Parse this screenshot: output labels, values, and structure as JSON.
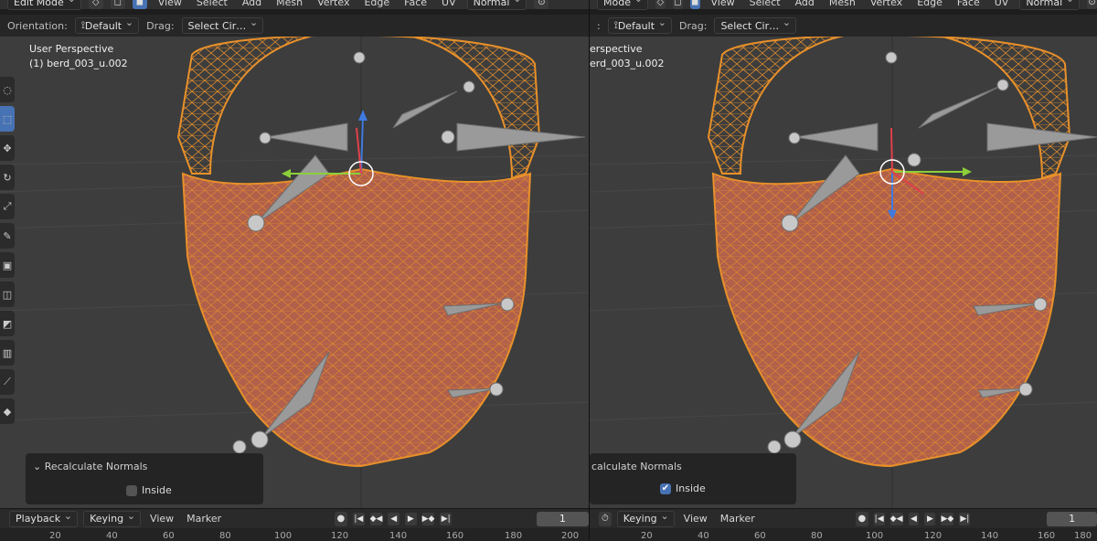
{
  "left": {
    "mode": "Edit Mode",
    "menus": [
      "View",
      "Select",
      "Add",
      "Mesh",
      "Vertex",
      "Edge",
      "Face",
      "UV"
    ],
    "transform_orientation": "Normal",
    "orientation_label": "Orientation:",
    "orientation_value": "Default",
    "drag_label": "Drag:",
    "drag_value": "Select Cir…",
    "perspective": "User Perspective",
    "object_name": "(1) berd_003_u.002",
    "redo_title": "Recalculate Normals",
    "inside_label": "Inside",
    "inside_checked": false
  },
  "right": {
    "mode": "Mode",
    "menus": [
      "View",
      "Select",
      "Add",
      "Mesh",
      "Vertex",
      "Edge",
      "Face",
      "UV"
    ],
    "transform_orientation": "Normal",
    "orientation_label": ":",
    "orientation_value": "Default",
    "drag_label": "Drag:",
    "drag_value": "Select Cir…",
    "perspective": "erspective",
    "object_name": "erd_003_u.002",
    "redo_title": "calculate Normals",
    "inside_label": "Inside",
    "inside_checked": true
  },
  "timeline_left": {
    "playback": "Playback",
    "keying": "Keying",
    "view": "View",
    "marker": "Marker",
    "frame": "1",
    "ticks": [
      "20",
      "40",
      "60",
      "80",
      "100",
      "120",
      "140",
      "160",
      "180",
      "200"
    ]
  },
  "timeline_right": {
    "keying": "Keying",
    "view": "View",
    "marker": "Marker",
    "frame": "1",
    "ticks": [
      "20",
      "40",
      "60",
      "80",
      "100",
      "120",
      "140",
      "160",
      "180"
    ]
  },
  "colors": {
    "mesh_wire": "#e8902a",
    "mesh_fill": "#b0604b",
    "viewport_bg": "#3d3d3d",
    "accent": "#4772b3"
  },
  "icons": [
    "cursor-icon",
    "move-icon",
    "rotate-icon",
    "scale-icon",
    "transform-icon",
    "annotate-icon",
    "measure-icon",
    "extrude-icon",
    "inset-icon",
    "bevel-icon",
    "loopcut-icon",
    "knife-icon",
    "polybuild-icon"
  ]
}
